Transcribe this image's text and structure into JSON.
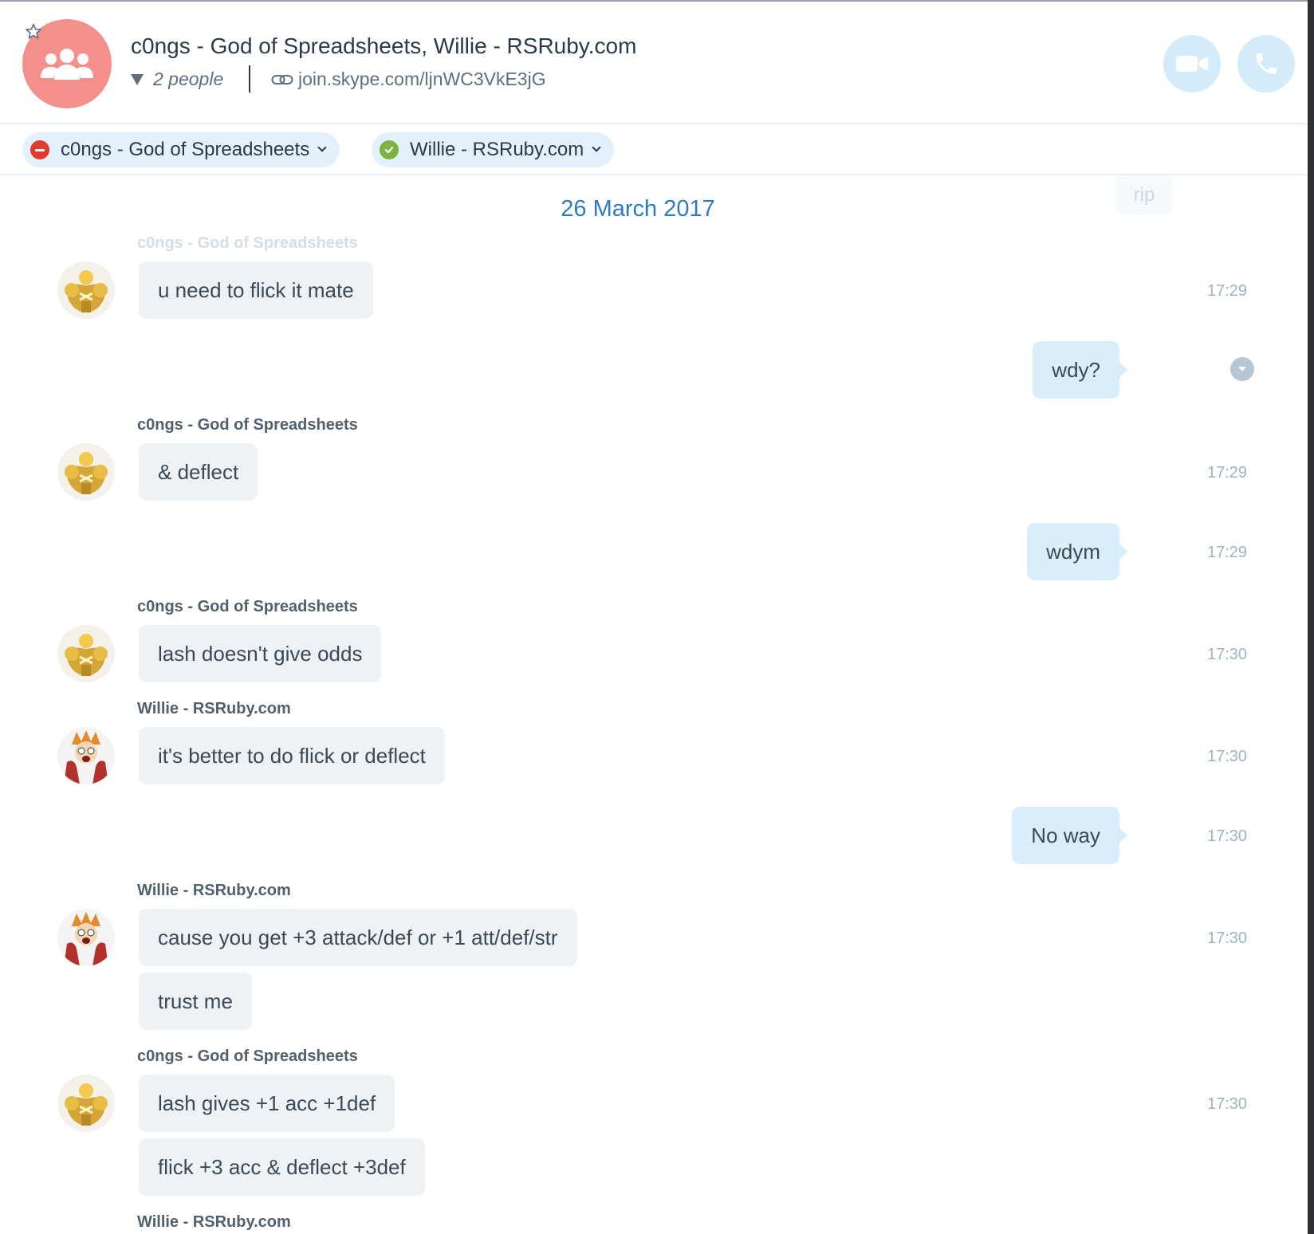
{
  "header": {
    "title": "c0ngs - God of Spreadsheets, Willie - RSRuby.com",
    "people_count": "2 people",
    "join_link": "join.skype.com/ljnWC3VkE3jG",
    "accent_color": "#f3908b"
  },
  "participants": [
    {
      "name": "c0ngs - God of Spreadsheets",
      "status": "do-not-disturb"
    },
    {
      "name": "Willie - RSRuby.com",
      "status": "online"
    }
  ],
  "chat": {
    "faded_message": "rip",
    "date_separator": "26 March 2017",
    "messages": [
      {
        "sender": "c0ngs - God of Spreadsheets",
        "text": "u need to flick it mate",
        "time": "17:29",
        "direction": "incoming"
      },
      {
        "sender": "",
        "text": "wdy?",
        "time": "",
        "direction": "outgoing"
      },
      {
        "sender": "c0ngs - God of Spreadsheets",
        "text": "& deflect",
        "time": "17:29",
        "direction": "incoming"
      },
      {
        "sender": "",
        "text": "wdym",
        "time": "17:29",
        "direction": "outgoing"
      },
      {
        "sender": "c0ngs - God of Spreadsheets",
        "text": "lash doesn't give odds",
        "time": "17:30",
        "direction": "incoming"
      },
      {
        "sender": "Willie - RSRuby.com",
        "text": "it's better to do flick or deflect",
        "time": "17:30",
        "direction": "incoming"
      },
      {
        "sender": "",
        "text": "No way",
        "time": "17:30",
        "direction": "outgoing"
      },
      {
        "sender": "Willie - RSRuby.com",
        "text": "cause you get +3 attack/def or +1 att/def/str",
        "time": "17:30",
        "direction": "incoming"
      },
      {
        "sender": "",
        "text": "trust me",
        "time": "",
        "direction": "incoming"
      },
      {
        "sender": "c0ngs - God of Spreadsheets",
        "text": "lash gives +1 acc +1def",
        "time": "17:30",
        "direction": "incoming"
      },
      {
        "sender": "",
        "text": "flick +3 acc & deflect +3def",
        "time": "",
        "direction": "incoming"
      },
      {
        "sender": "Willie - RSRuby.com",
        "text": "",
        "time": "",
        "direction": "incoming"
      }
    ]
  }
}
